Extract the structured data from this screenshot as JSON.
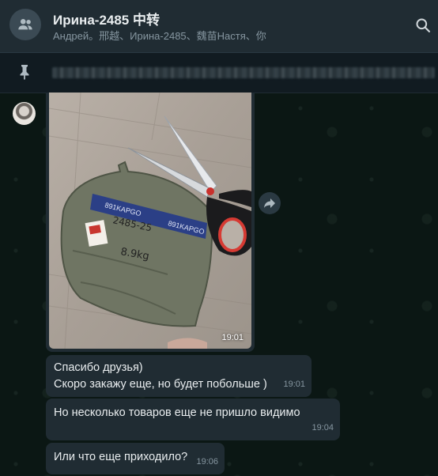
{
  "header": {
    "title": "Ирина-2485 中转",
    "subtitle": "Андрей。邢越、Ирина-2485、魏苗Настя、你",
    "group_icon": "group-icon",
    "search_icon": "search-icon"
  },
  "pinned": {
    "icon": "pin-icon"
  },
  "messages": [
    {
      "type": "image",
      "time": "19:01",
      "forward_icon": "forward-icon"
    },
    {
      "type": "text",
      "lines": [
        "Спасибо друзья)",
        "Скоро закажу еще, но будет побольше )"
      ],
      "time": "19:01"
    },
    {
      "type": "text",
      "lines": [
        "Но несколько товаров еще не пришло видимо"
      ],
      "time": "19:04"
    },
    {
      "type": "text",
      "lines": [
        "Или что еще приходило?"
      ],
      "time": "19:06"
    }
  ],
  "colors": {
    "header_bg": "#202c33",
    "bubble_bg": "#202c33",
    "chat_bg": "#0b1714",
    "meta_text": "#8696a0"
  }
}
